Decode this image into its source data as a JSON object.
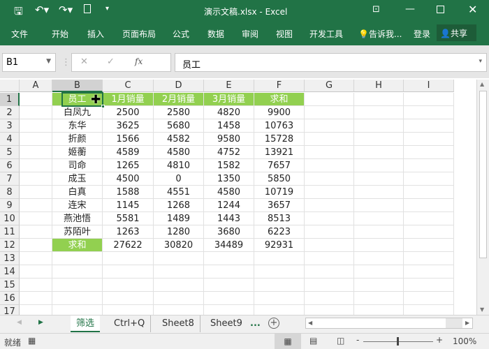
{
  "title": "演示文稿.xlsx - Excel",
  "ribbon": [
    "文件",
    "开始",
    "插入",
    "页面布局",
    "公式",
    "数据",
    "审阅",
    "视图",
    "开发工具"
  ],
  "tell_me": "告诉我...",
  "login": "登录",
  "share": "共享",
  "name_box": "B1",
  "formula": "员工",
  "fx": "fx",
  "columns": [
    "A",
    "B",
    "C",
    "D",
    "E",
    "F",
    "G",
    "H",
    "I"
  ],
  "rows": [
    "1",
    "2",
    "3",
    "4",
    "5",
    "6",
    "7",
    "8",
    "9",
    "10",
    "11",
    "12",
    "13",
    "14",
    "15",
    "16",
    "17"
  ],
  "table": {
    "header": [
      "员工",
      "1月销量",
      "2月销量",
      "3月销量",
      "求和"
    ],
    "body": [
      [
        "白凤九",
        "2500",
        "2580",
        "4820",
        "9900"
      ],
      [
        "东华",
        "3625",
        "5680",
        "1458",
        "10763"
      ],
      [
        "折颜",
        "1566",
        "4582",
        "9580",
        "15728"
      ],
      [
        "姬蘅",
        "4589",
        "4580",
        "4752",
        "13921"
      ],
      [
        "司命",
        "1265",
        "4810",
        "1582",
        "7657"
      ],
      [
        "成玉",
        "4500",
        "0",
        "1350",
        "5850"
      ],
      [
        "白真",
        "1588",
        "4551",
        "4580",
        "10719"
      ],
      [
        "连宋",
        "1145",
        "1268",
        "1244",
        "3657"
      ],
      [
        "燕池悟",
        "5581",
        "1489",
        "1443",
        "8513"
      ],
      [
        "苏陌叶",
        "1263",
        "1280",
        "3680",
        "6223"
      ]
    ],
    "total": [
      "求和",
      "27622",
      "30820",
      "34489",
      "92931"
    ]
  },
  "sheets": [
    "筛选",
    "Ctrl+Q",
    "Sheet8",
    "Sheet9",
    "..."
  ],
  "active_sheet": "筛选",
  "status": "就绪",
  "zoom": "100%",
  "colors": {
    "excel_green": "#217346",
    "header_fill": "#92d050"
  }
}
